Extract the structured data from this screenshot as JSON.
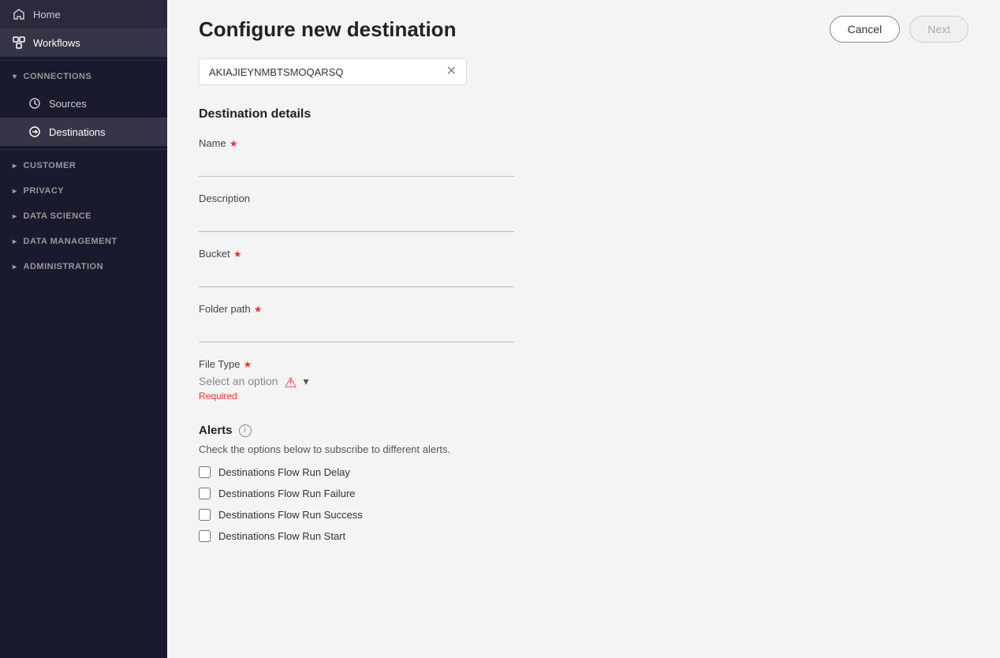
{
  "sidebar": {
    "items": [
      {
        "id": "home",
        "label": "Home",
        "icon": "home-icon",
        "active": false
      },
      {
        "id": "workflows",
        "label": "Workflows",
        "icon": "workflows-icon",
        "active": true
      }
    ],
    "sections": [
      {
        "id": "connections",
        "label": "CONNECTIONS",
        "children": [
          {
            "id": "sources",
            "label": "Sources",
            "active": false
          },
          {
            "id": "destinations",
            "label": "Destinations",
            "active": true
          }
        ]
      },
      {
        "id": "customer",
        "label": "CUSTOMER",
        "children": []
      },
      {
        "id": "privacy",
        "label": "PRIVACY",
        "children": []
      },
      {
        "id": "data-science",
        "label": "DATA SCIENCE",
        "children": []
      },
      {
        "id": "data-management",
        "label": "DATA MANAGEMENT",
        "children": []
      },
      {
        "id": "administration",
        "label": "ADMINISTRATION",
        "children": []
      }
    ]
  },
  "header": {
    "title": "Configure new destination",
    "cancel_label": "Cancel",
    "next_label": "Next"
  },
  "search": {
    "value": "AKIAJIEYNMBTSMOQARSQ",
    "placeholder": ""
  },
  "destination_details": {
    "section_title": "Destination details",
    "fields": [
      {
        "id": "name",
        "label": "Name",
        "required": true,
        "value": ""
      },
      {
        "id": "description",
        "label": "Description",
        "required": false,
        "value": ""
      },
      {
        "id": "bucket",
        "label": "Bucket",
        "required": true,
        "value": ""
      },
      {
        "id": "folder_path",
        "label": "Folder path",
        "required": true,
        "value": ""
      }
    ],
    "file_type": {
      "label": "File Type",
      "required": true,
      "placeholder": "Select an option",
      "required_text": "Required"
    }
  },
  "alerts": {
    "title": "Alerts",
    "description": "Check the options below to subscribe to different alerts.",
    "options": [
      {
        "id": "flow-run-delay",
        "label": "Destinations Flow Run Delay",
        "checked": false
      },
      {
        "id": "flow-run-failure",
        "label": "Destinations Flow Run Failure",
        "checked": false
      },
      {
        "id": "flow-run-success",
        "label": "Destinations Flow Run Success",
        "checked": false
      },
      {
        "id": "flow-run-start",
        "label": "Destinations Flow Run Start",
        "checked": false
      }
    ]
  }
}
